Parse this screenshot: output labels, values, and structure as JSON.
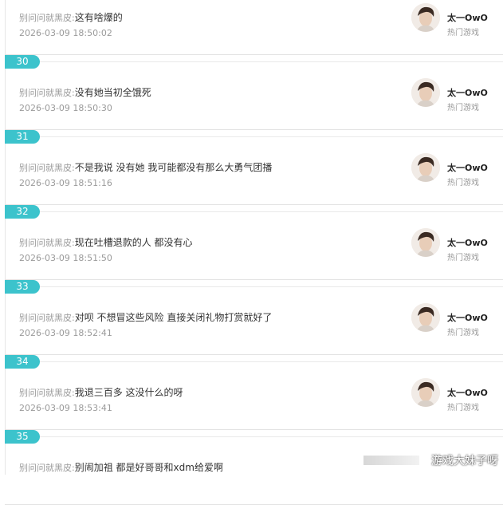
{
  "comments": [
    {
      "num": "",
      "user": "别问问就黑皮:",
      "text": "这有啥爆的",
      "time": "2026-03-09 18:50:02",
      "author": "太一OwO",
      "tag": "热门游戏"
    },
    {
      "num": "30",
      "user": "别问问就黑皮:",
      "text": "没有她当初全饿死",
      "time": "2026-03-09 18:50:30",
      "author": "太一OwO",
      "tag": "热门游戏"
    },
    {
      "num": "31",
      "user": "别问问就黑皮:",
      "text": "不是我说 没有她 我可能都没有那么大勇气团播",
      "time": "2026-03-09 18:51:16",
      "author": "太一OwO",
      "tag": "热门游戏"
    },
    {
      "num": "32",
      "user": "别问问就黑皮:",
      "text": "现在吐槽退款的人 都没有心",
      "time": "2026-03-09 18:51:50",
      "author": "太一OwO",
      "tag": "热门游戏"
    },
    {
      "num": "33",
      "user": "别问问就黑皮:",
      "text": "对呗 不想冒这些风险 直接关闭礼物打赏就好了",
      "time": "2026-03-09 18:52:41",
      "author": "太一OwO",
      "tag": "热门游戏"
    },
    {
      "num": "34",
      "user": "别问问就黑皮:",
      "text": "我退三百多 这没什么的呀",
      "time": "2026-03-09 18:53:41",
      "author": "太一OwO",
      "tag": "热门游戏"
    },
    {
      "num": "35",
      "user": "别问问就黑皮:",
      "text": "别闹加祖 都是好哥哥和xdm给爱啊",
      "time": "",
      "author": "",
      "tag": ""
    }
  ],
  "watermark": "游戏大妹子呀"
}
